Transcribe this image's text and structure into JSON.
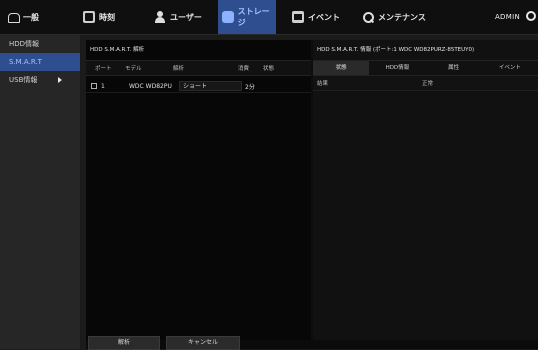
{
  "topnav": {
    "items": [
      {
        "label": "一般",
        "icon": "home-icon"
      },
      {
        "label": "時刻",
        "icon": "clock-icon"
      },
      {
        "label": "ユーザー",
        "icon": "user-icon"
      },
      {
        "label": "ストレージ",
        "icon": "storage-icon",
        "active": true
      },
      {
        "label": "イベント",
        "icon": "event-icon"
      },
      {
        "label": "メンテナンス",
        "icon": "maintenance-icon"
      }
    ],
    "user": "ADMIN",
    "colors": {
      "active_bg": "#2f4e8f",
      "active_text": "#a9c3ff"
    }
  },
  "sidebar": {
    "items": [
      {
        "label": "HDD情報"
      },
      {
        "label": "S.M.A.R.T",
        "active": true
      },
      {
        "label": "USB情報"
      }
    ]
  },
  "left": {
    "title": "HDD S.M.A.R.T. 解析",
    "headers": [
      "ポート",
      "モデル",
      "解析",
      "消費",
      "状態"
    ],
    "rows": [
      {
        "port": "1",
        "model": "WDC WD82PU",
        "analysis": "ショート",
        "time": "2分",
        "status": ""
      }
    ]
  },
  "right": {
    "title": "HDD S.M.A.R.T. 情報 (ポート:1 WDC WD82PURZ-85TEUY0)",
    "tabs": [
      "状態",
      "HDD情報",
      "属性",
      "イベント"
    ],
    "result_headers": [
      "結果",
      "正常"
    ]
  },
  "buttons": {
    "analyze": "解析",
    "cancel": "キャンセル"
  }
}
